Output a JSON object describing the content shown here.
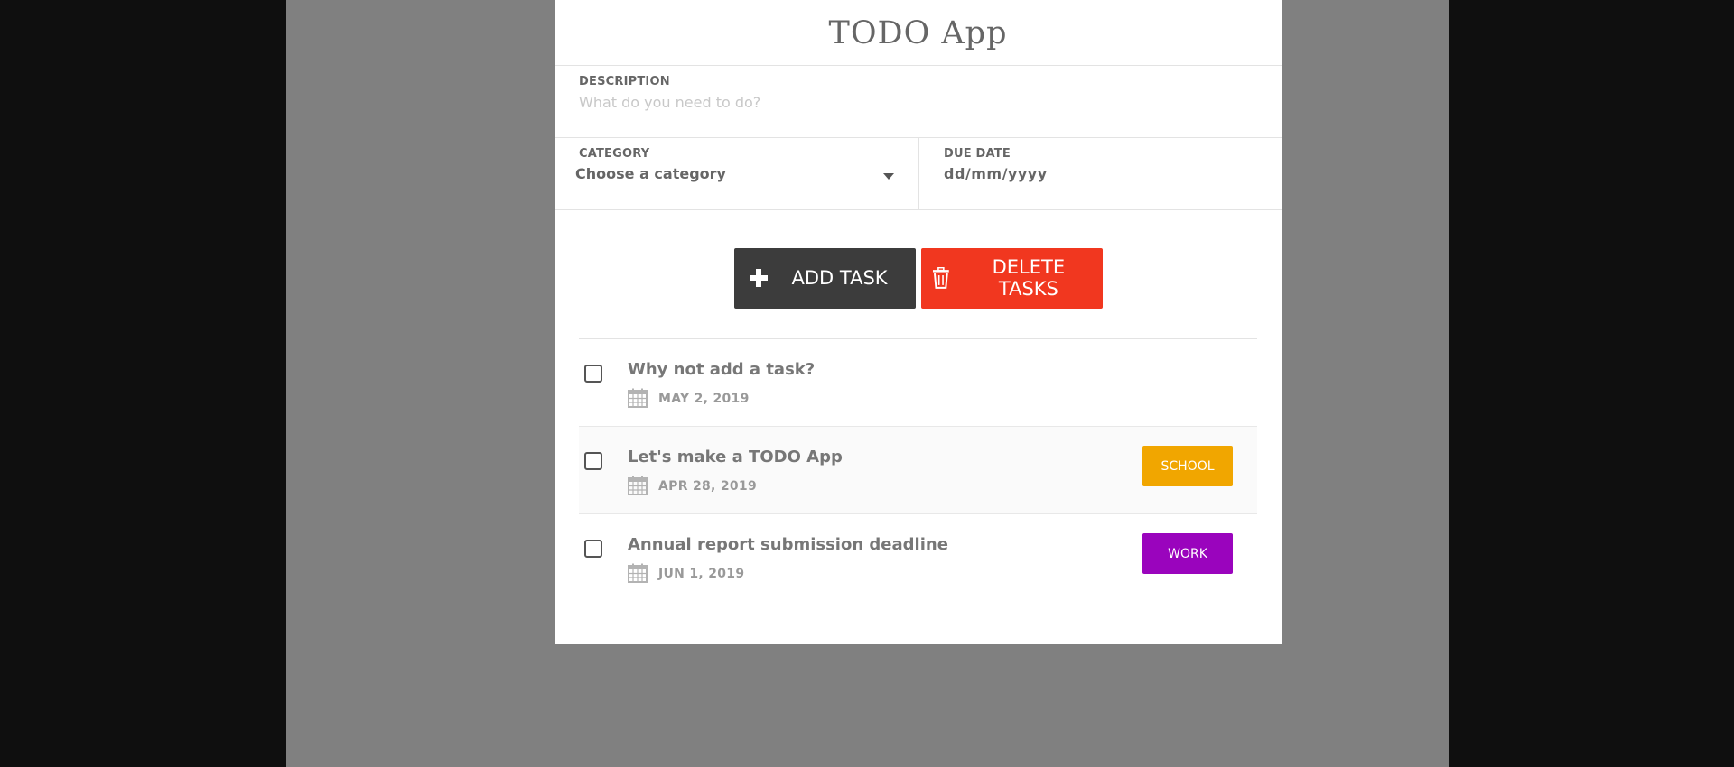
{
  "app": {
    "title": "TODO App"
  },
  "form": {
    "description": {
      "label": "DESCRIPTION",
      "placeholder": "What do you need to do?",
      "value": ""
    },
    "category": {
      "label": "CATEGORY",
      "selected": "Choose a category"
    },
    "due_date": {
      "label": "DUE DATE",
      "value": "dd/mm/yyyy"
    }
  },
  "actions": {
    "add_label": "ADD TASK",
    "delete_label": "DELETE TASKS",
    "add_color": "#3c3c3c",
    "delete_color": "#f1371f"
  },
  "tasks": [
    {
      "title": "Why not add a task?",
      "date": "MAY 2, 2019",
      "tag": "",
      "tag_color": "",
      "checked": false
    },
    {
      "title": "Let's make a TODO App",
      "date": "APR 28, 2019",
      "tag": "SCHOOL",
      "tag_color": "#f1a600",
      "checked": false
    },
    {
      "title": "Annual report submission deadline",
      "date": "JUN 1, 2019",
      "tag": "WORK",
      "tag_color": "#9a04bd",
      "checked": false
    }
  ],
  "icons": {
    "add": "plus-icon",
    "delete": "trash-icon",
    "date": "calendar-icon",
    "select": "chevron-down-icon"
  }
}
